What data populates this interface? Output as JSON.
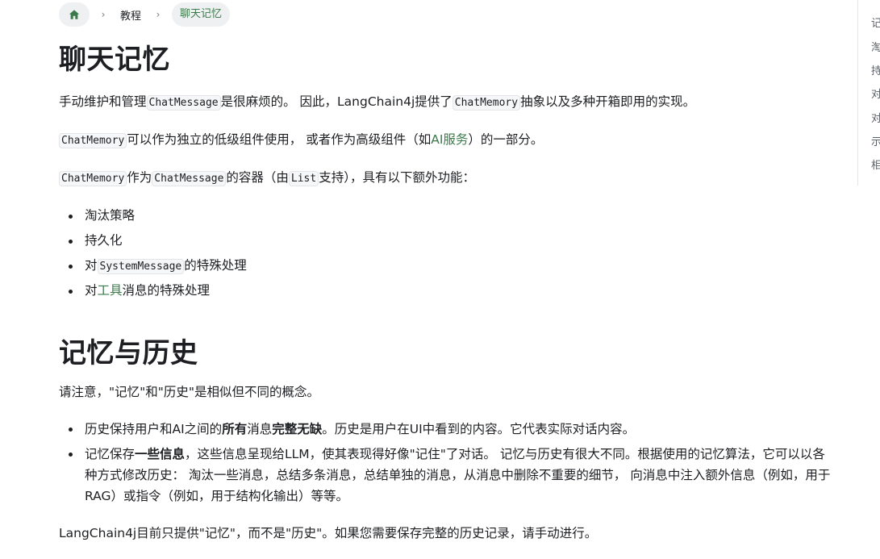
{
  "breadcrumb": {
    "home_icon": "home-icon",
    "separator": "›",
    "items": [
      "教程",
      "聊天记忆"
    ]
  },
  "sections": {
    "title1": "聊天记忆",
    "p1": {
      "t1": "手动维护和管理",
      "c1": "ChatMessage",
      "t2": "是很麻烦的。 因此，LangChain4j提供了",
      "c2": "ChatMemory",
      "t3": "抽象以及多种开箱即用的实现。"
    },
    "p2": {
      "c1": "ChatMemory",
      "t1": "可以作为独立的低级组件使用， 或者作为高级组件（如",
      "link": "AI服务",
      "t2": "）的一部分。"
    },
    "p3": {
      "c1": "ChatMemory",
      "t1": "作为",
      "c2": "ChatMessage",
      "t2": "的容器（由",
      "c3": "List",
      "t3": "支持），具有以下额外功能："
    },
    "list1": {
      "i1": "淘汰策略",
      "i2": "持久化",
      "i3_pre": "对",
      "i3_code": "SystemMessage",
      "i3_post": "的特殊处理",
      "i4_pre": "对",
      "i4_link": "工具",
      "i4_post": "消息的特殊处理"
    },
    "title2": "记忆与历史",
    "p4": "请注意，\"记忆\"和\"历史\"是相似但不同的概念。",
    "list2": {
      "i1_a": "历史保持用户和AI之间的",
      "i1_b1": "所有",
      "i1_c": "消息",
      "i1_b2": "完整无缺",
      "i1_d": "。历史是用户在UI中看到的内容。它代表实际对话内容。",
      "i2_a": "记忆保存",
      "i2_b": "一些信息",
      "i2_c": "，这些信息呈现给LLM，使其表现得好像\"记住\"了对话。 记忆与历史有很大不同。根据使用的记忆算法，它可以以各种方式修改历史： 淘汰一些消息，总结多条消息，总结单独的消息，从消息中删除不重要的细节， 向消息中注入额外信息（例如，用于RAG）或指令（例如，用于结构化输出）等等。"
    },
    "p5": "LangChain4j目前只提供\"记忆\"，而不是\"历史\"。如果您需要保存完整的历史记录，请手动进行。"
  },
  "toc": [
    "记",
    "淘",
    "持",
    "对",
    "对",
    "示",
    "相"
  ],
  "colors": {
    "accent": "#3b7a4a",
    "text": "#1c1e21",
    "chip_bg": "#eef0f2"
  }
}
